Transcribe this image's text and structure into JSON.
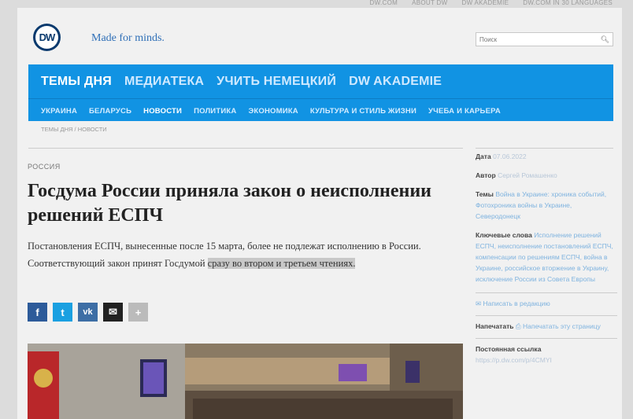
{
  "topbar": {
    "links": [
      "DW.COM",
      "ABOUT DW",
      "DW AKADEMIE",
      "DW.COM IN 30 LANGUAGES"
    ]
  },
  "header": {
    "logo_text": "DW",
    "slogan": "Made for minds.",
    "search_placeholder": "Поиск",
    "search_icon": "search-icon"
  },
  "nav": {
    "main": [
      "ТЕМЫ ДНЯ",
      "МЕДИАТЕКА",
      "УЧИТЬ НЕМЕЦКИЙ",
      "DW AKADEMIE"
    ],
    "sub": [
      "УКРАИНА",
      "БЕЛАРУСЬ",
      "НОВОСТИ",
      "ПОЛИТИКА",
      "ЭКОНОМИКА",
      "КУЛЬТУРА И СТИЛЬ ЖИЗНИ",
      "УЧЕБА И КАРЬЕРА"
    ],
    "active_sub": "НОВОСТИ"
  },
  "breadcrumb": "ТЕМЫ ДНЯ / НОВОСТИ",
  "article": {
    "category": "РОССИЯ",
    "headline": "Госдума России приняла закон о неисполнении решений ЕСПЧ",
    "lead_plain": "Постановления ЕСПЧ, вынесенные после 15 марта, более не подлежат исполнению в России. Соответствующий закон принят Госдумой ",
    "lead_highlight": "сразу во втором и третьем чтениях."
  },
  "share": {
    "facebook": "f",
    "twitter": "t",
    "vk": "vk",
    "email": "✉",
    "more": "+"
  },
  "sidebar": {
    "date_label": "Дата",
    "date_value": "07.06.2022",
    "author_label": "Автор",
    "author_value": "Сергей Ромашенко",
    "topics_label": "Темы",
    "topics_value": "Война в Украине: хроника событий, Фотохроника войны в Украине, Северодонецк",
    "keywords_label": "Ключевые слова",
    "keywords_value": "Исполнение решений ЕСПЧ, неисполнение постановлений ЕСПЧ, компенсации по решениям ЕСПЧ, война в Украине, российское вторжение в Украину, исключение России из Совета Европы",
    "write_label": "Написать в редакцию",
    "print_label": "Напечатать",
    "print_value": "Напечатать эту страницу",
    "permalink_label": "Постоянная ссылка",
    "permalink_value": "https://p.dw.com/p/4CMYI"
  },
  "colors": {
    "nav_bg": "#1193e3",
    "logo_blue": "#0a3a6e",
    "slogan_blue": "#2f6fb7"
  }
}
